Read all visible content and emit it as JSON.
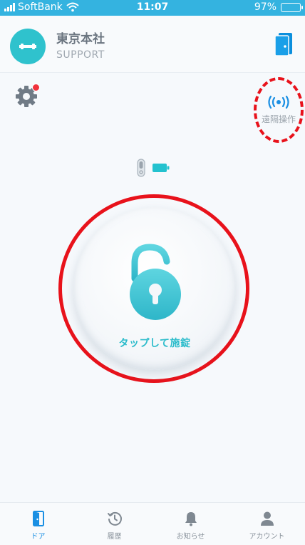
{
  "status_bar": {
    "carrier": "SoftBank",
    "time": "11:07",
    "battery": "97%"
  },
  "header": {
    "title": "東京本社",
    "subtitle": "SUPPORT"
  },
  "remote": {
    "label": "遠隔操作"
  },
  "lock": {
    "action_label": "タップして施錠"
  },
  "tabs": [
    {
      "label": "ドア",
      "icon": "door-icon",
      "active": true
    },
    {
      "label": "履歴",
      "icon": "history-icon",
      "active": false
    },
    {
      "label": "お知らせ",
      "icon": "bell-icon",
      "active": false
    },
    {
      "label": "アカウント",
      "icon": "person-icon",
      "active": false
    }
  ],
  "colors": {
    "status_bar": "#34b3e0",
    "accent_teal": "#2fc2cd",
    "active_tab": "#1a8fe3",
    "notification_dot": "#f0323c",
    "annotation_red": "#e8121b"
  }
}
